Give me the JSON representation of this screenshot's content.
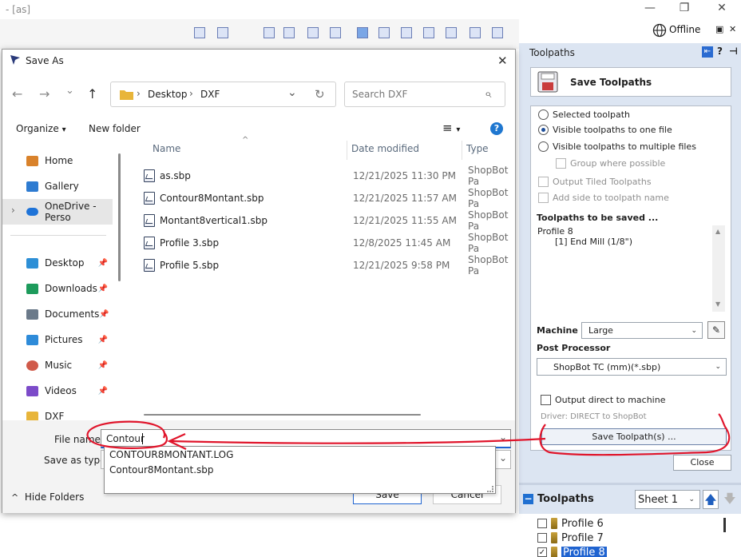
{
  "app": {
    "title": "- [as]",
    "minimize_glyph": "—",
    "maximize_glyph": "❐",
    "close_glyph": "✕",
    "offline_label": "Offline",
    "restore_glyph": "▣",
    "panel_close_glyph": "✕"
  },
  "dialog": {
    "title": "Save As",
    "close_glyph": "✕",
    "nav": {
      "back": "←",
      "forward": "→",
      "recent": "⌄",
      "up": "↑"
    },
    "address": {
      "crumbs": [
        "Desktop",
        "DXF"
      ],
      "separator": "›",
      "dropdown": "⌄",
      "refresh": "↻"
    },
    "search": {
      "placeholder": "Search DXF",
      "icon": "⌕"
    },
    "toolbar": {
      "organize": "Organize",
      "new_folder": "New folder",
      "dropdown": "▾",
      "view_icon": "≡",
      "help": "?"
    },
    "sidebar": {
      "items": [
        {
          "label": "Home",
          "icon": "home-icon",
          "color": "#d9822b",
          "pinned": false
        },
        {
          "label": "Gallery",
          "icon": "gallery-icon",
          "color": "#2e7bd1",
          "pinned": false
        },
        {
          "label": "OneDrive - Perso",
          "icon": "onedrive-icon",
          "color": "#1e73d8",
          "pinned": false,
          "selected": true
        },
        {
          "label": "Desktop",
          "icon": "desktop-icon",
          "color": "#2d8fd6",
          "pinned": true
        },
        {
          "label": "Downloads",
          "icon": "downloads-icon",
          "color": "#1d9b5c",
          "pinned": true
        },
        {
          "label": "Documents",
          "icon": "documents-icon",
          "color": "#6b7a8a",
          "pinned": true
        },
        {
          "label": "Pictures",
          "icon": "pictures-icon",
          "color": "#2e8bd9",
          "pinned": true
        },
        {
          "label": "Music",
          "icon": "music-icon",
          "color": "#d05a4a",
          "pinned": true
        },
        {
          "label": "Videos",
          "icon": "videos-icon",
          "color": "#7c4bc9",
          "pinned": true
        },
        {
          "label": "DXF",
          "icon": "folder-icon",
          "color": "#e8b53a",
          "pinned": false
        }
      ],
      "expand_glyph": "›",
      "pin_glyph": "📌"
    },
    "columns": {
      "name": "Name",
      "date": "Date modified",
      "type": "Type",
      "sort_glyph": "^"
    },
    "files": [
      {
        "name": "as.sbp",
        "date": "12/21/2025 11:30 PM",
        "type": "ShopBot Pa"
      },
      {
        "name": "Contour8Montant.sbp",
        "date": "12/21/2025 11:57 AM",
        "type": "ShopBot Pa"
      },
      {
        "name": "Montant8vertical1.sbp",
        "date": "12/21/2025 11:55 AM",
        "type": "ShopBot Pa"
      },
      {
        "name": "Profile 3.sbp",
        "date": "12/8/2025 11:45 AM",
        "type": "ShopBot Pa"
      },
      {
        "name": "Profile 5.sbp",
        "date": "12/21/2025 9:58 PM",
        "type": "ShopBot Pa"
      }
    ],
    "filename_label": "File name:",
    "filename_value": "Contour",
    "saveas_label": "Save as type:",
    "autocomplete": [
      "CONTOUR8MONTANT.LOG",
      "Contour8Montant.sbp"
    ],
    "hide_folders": "Hide Folders",
    "hide_glyph": "^",
    "save_label": "Save",
    "cancel_label": "Cancel",
    "combo_arrow": "⌄"
  },
  "panel": {
    "title": "Toolpaths",
    "header_icons": [
      "⇤",
      "?",
      "⊣"
    ],
    "save_title": "Save Toolpaths",
    "options": [
      {
        "label": "Selected toolpath",
        "checked": false
      },
      {
        "label": "Visible toolpaths to one file",
        "checked": true
      },
      {
        "label": "Visible toolpaths to multiple files",
        "checked": false
      }
    ],
    "group_label": "Group where possible",
    "tiled_label": "Output Tiled Toolpaths",
    "sidename_label": "Add side to toolpath name",
    "to_save_title": "Toolpaths to be saved ...",
    "to_save": [
      "Profile 8",
      "[1] End Mill (1/8\")"
    ],
    "machine_label": "Machine",
    "machine_value": "Large",
    "post_label": "Post Processor",
    "post_value": "ShopBot TC (mm)(*.sbp)",
    "direct_label": "Output direct to machine",
    "driver_text": "Driver: DIRECT to ShopBot",
    "save_button": "Save Toolpath(s) ...",
    "close_button": "Close",
    "scroll_up": "▲",
    "scroll_down": "▼",
    "dd_arrow": "⌄",
    "edit_icon": "✎"
  },
  "toolpaths": {
    "title": "Toolpaths",
    "collapse_glyph": "−",
    "sheet": "Sheet 1",
    "up": "🡅",
    "down": "🡇",
    "items": [
      {
        "label": "Profile 6",
        "checked": false,
        "selected": false
      },
      {
        "label": "Profile 7",
        "checked": false,
        "selected": false
      },
      {
        "label": "Profile 8",
        "checked": true,
        "selected": true
      }
    ],
    "check_glyph": "✓"
  },
  "annotation": {
    "color": "#e0152b"
  }
}
